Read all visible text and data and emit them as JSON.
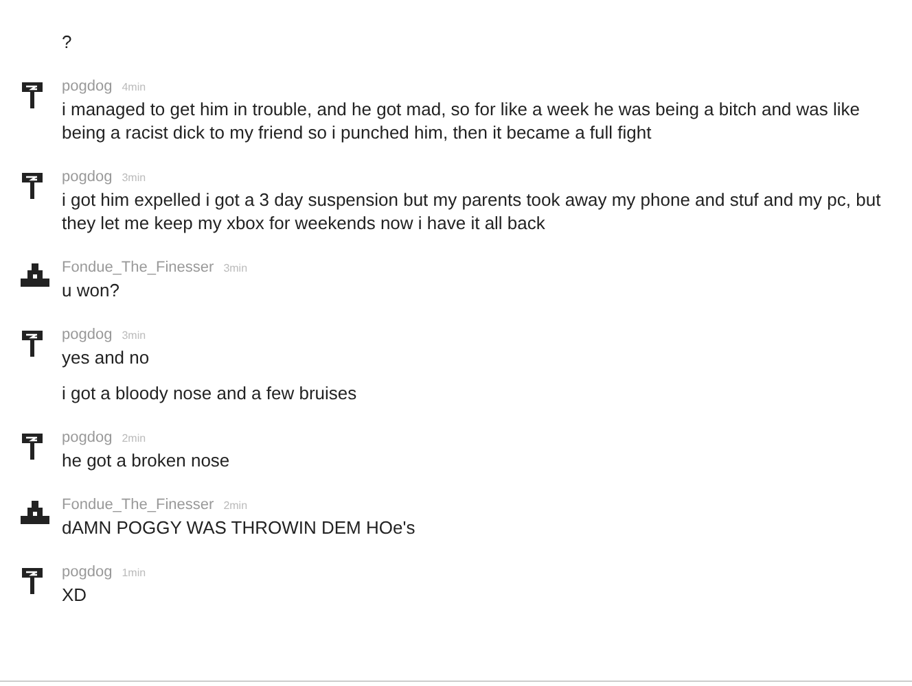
{
  "messages": [
    {
      "kind": "continuation",
      "texts": [
        "?"
      ]
    },
    {
      "kind": "post",
      "avatar": {
        "kind": "hammer"
      },
      "user": "pogdog",
      "time": "4min",
      "texts": [
        "i managed to get him in trouble, and he got mad, so for like a week he was being a bitch and was like being a racist dick to my friend so i punched him, then it became a full fight"
      ]
    },
    {
      "kind": "post",
      "avatar": {
        "kind": "hammer"
      },
      "user": "pogdog",
      "time": "3min",
      "texts": [
        "i got him expelled i got a 3 day suspension but my parents took away my phone and stuf and my pc, but they let me keep my xbox for weekends now i have it all back"
      ]
    },
    {
      "kind": "post",
      "avatar": {
        "kind": "building"
      },
      "user": "Fondue_The_Finesser",
      "time": "3min",
      "texts": [
        "u won?"
      ]
    },
    {
      "kind": "post",
      "avatar": {
        "kind": "hammer"
      },
      "user": "pogdog",
      "time": "3min",
      "texts": [
        "yes and no",
        "i got a bloody nose and a few bruises"
      ]
    },
    {
      "kind": "post",
      "avatar": {
        "kind": "hammer"
      },
      "user": "pogdog",
      "time": "2min",
      "texts": [
        "he got a broken nose"
      ]
    },
    {
      "kind": "post",
      "avatar": {
        "kind": "building"
      },
      "user": "Fondue_The_Finesser",
      "time": "2min",
      "texts": [
        "dAMN POGGY WAS THROWIN DEM HOe's"
      ]
    },
    {
      "kind": "post",
      "avatar": {
        "kind": "hammer"
      },
      "user": "pogdog",
      "time": "1min",
      "texts": [
        "XD"
      ]
    }
  ]
}
